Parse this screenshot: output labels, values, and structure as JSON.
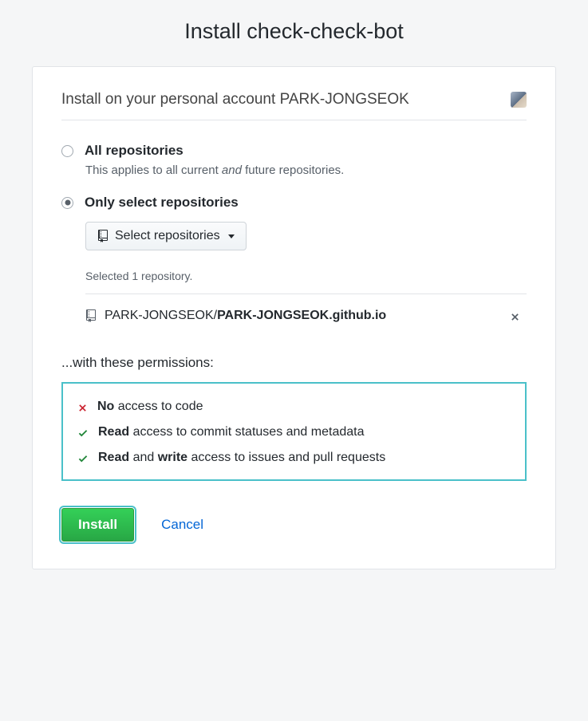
{
  "page_title": "Install check-check-bot",
  "account": {
    "prefix": "Install on your personal account ",
    "name": "PARK-JONGSEOK"
  },
  "options": {
    "all": {
      "label": "All repositories",
      "desc_before": "This applies to all current ",
      "desc_em": "and",
      "desc_after": " future repositories.",
      "selected": false
    },
    "select": {
      "label": "Only select repositories",
      "button_label": "Select repositories",
      "selected": true
    }
  },
  "selected_summary": "Selected 1 repository.",
  "selected_repos": [
    {
      "owner": "PARK-JONGSEOK/",
      "name": "PARK-JONGSEOK.github.io"
    }
  ],
  "permissions_intro": "...with these permissions:",
  "permissions": [
    {
      "icon": "x",
      "strong1": "No",
      "middle": " access to code",
      "strong2": "",
      "after": ""
    },
    {
      "icon": "check",
      "strong1": "Read",
      "middle": " access to commit statuses and metadata",
      "strong2": "",
      "after": ""
    },
    {
      "icon": "check",
      "strong1": "Read",
      "middle": " and ",
      "strong2": "write",
      "after": " access to issues and pull requests"
    }
  ],
  "actions": {
    "install": "Install",
    "cancel": "Cancel"
  }
}
